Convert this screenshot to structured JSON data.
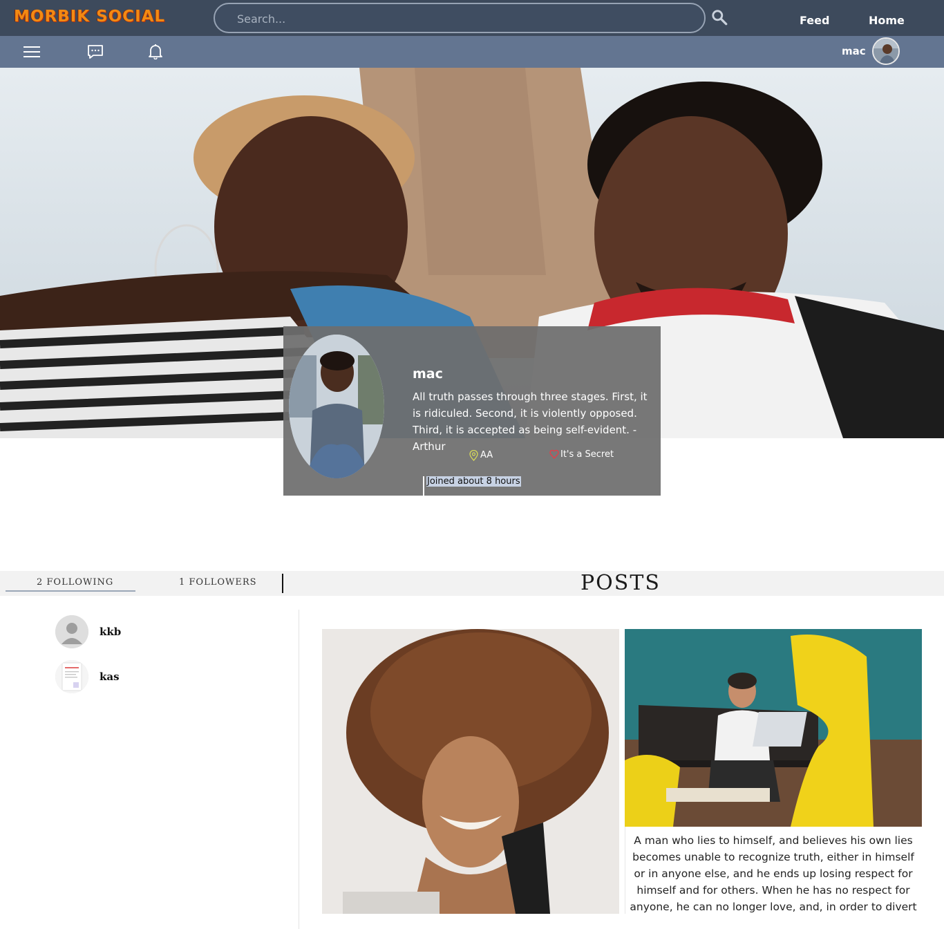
{
  "header": {
    "logo": "MORBIK SOCIAL",
    "search_placeholder": "Search...",
    "nav": [
      "Feed",
      "Home"
    ]
  },
  "subbar": {
    "icons": [
      "menu-icon",
      "chat-icon",
      "bell-icon"
    ],
    "username": "mac"
  },
  "profile": {
    "name": "mac",
    "bio": "All truth passes through three stages. First, it is ridiculed. Second, it is violently opposed. Third, it is accepted as being self-evident. -Arthur",
    "location": "AA",
    "relationship": "It's a Secret",
    "joined": "Joined about 8 hours"
  },
  "tabs": {
    "following": "2 FOLLOWING",
    "followers": "1 FOLLOWERS",
    "posts_title": "POSTS"
  },
  "following": [
    {
      "name": "kkb"
    },
    {
      "name": "kas"
    }
  ],
  "posts": [
    {
      "text": ""
    },
    {
      "text": "A man who lies to himself, and believes his own lies becomes unable to recognize truth, either in himself or in anyone else, and he ends up losing respect for himself and for others. When he has no respect for anyone, he can no longer love, and, in order to divert himself, having no love"
    }
  ],
  "colors": {
    "topbar": "#3d4a5c",
    "subbar": "#637591",
    "logo": "#f28a13"
  }
}
